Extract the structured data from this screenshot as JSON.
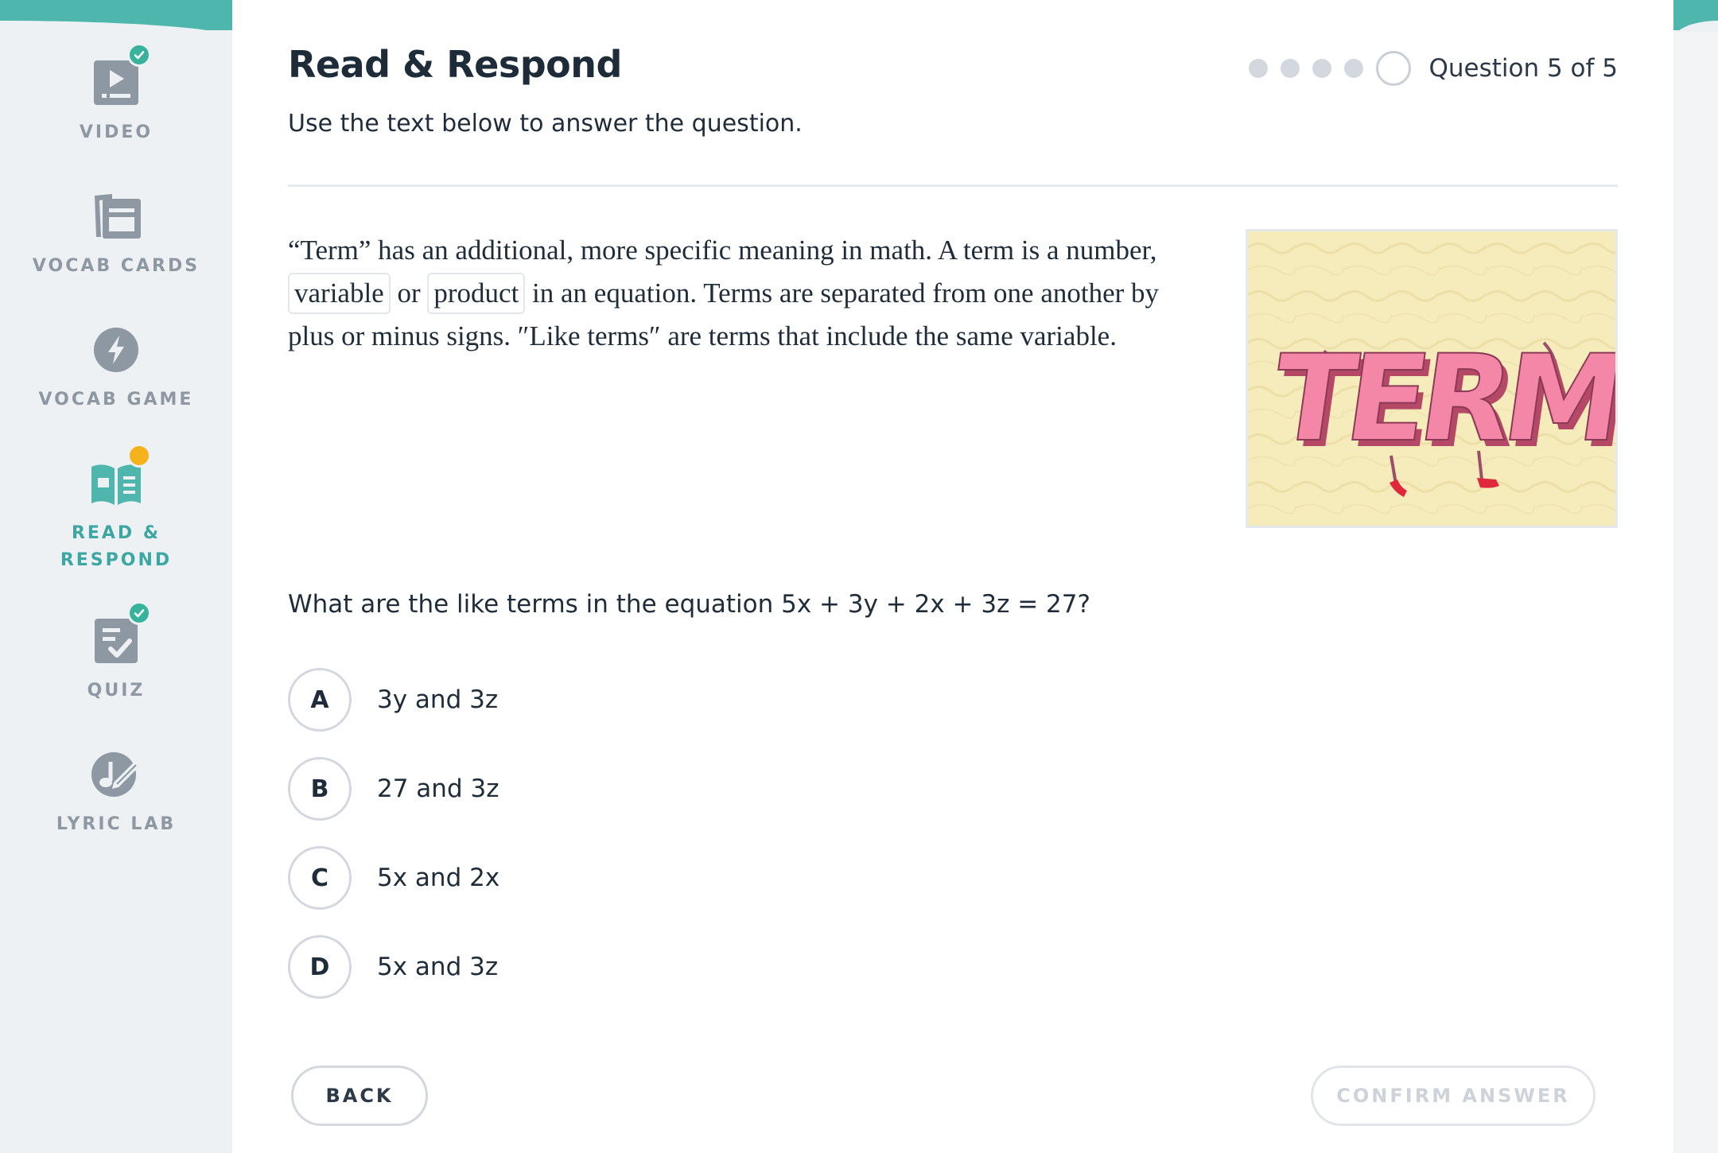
{
  "colors": {
    "accent": "#4fb6ad",
    "done_badge": "#36b39a",
    "current_badge": "#f6b21b",
    "nav_inactive": "#8e98a3",
    "nav_active": "#3ba7a3"
  },
  "sidebar": {
    "items": [
      {
        "label": "VIDEO",
        "icon": "video-player-icon",
        "status": "completed"
      },
      {
        "label": "VOCAB CARDS",
        "icon": "vocab-cards-icon",
        "status": "none"
      },
      {
        "label": "VOCAB GAME",
        "icon": "lightning-bolt-icon",
        "status": "none"
      },
      {
        "label": "READ &\nRESPOND",
        "icon": "open-book-icon",
        "status": "current"
      },
      {
        "label": "QUIZ",
        "icon": "quiz-checklist-icon",
        "status": "completed"
      },
      {
        "label": "LYRIC LAB",
        "icon": "music-note-pencil-icon",
        "status": "none"
      }
    ]
  },
  "header": {
    "title": "Read & Respond",
    "instruction": "Use the text below to answer the question.",
    "progress_text": "Question 5 of 5",
    "progress_current": 5,
    "progress_total": 5
  },
  "passage": {
    "part1": "“Term” has an additional, more specific meaning in math. A term is a number, ",
    "term1": "variable",
    "part2": " or ",
    "term2": "product",
    "part3": " in an equation. Terms are separated from one another by plus or minus signs. ″Like terms″ are terms that include the same variable."
  },
  "image": {
    "lettering": "TERM"
  },
  "question": {
    "text": "What are the like terms in the equation 5x + 3y + 2x + 3z = 27?",
    "choices": [
      {
        "letter": "A",
        "text": "3y and 3z"
      },
      {
        "letter": "B",
        "text": "27 and 3z"
      },
      {
        "letter": "C",
        "text": "5x and 2x"
      },
      {
        "letter": "D",
        "text": "5x and 3z"
      }
    ]
  },
  "buttons": {
    "back": "BACK",
    "confirm": "CONFIRM ANSWER"
  }
}
